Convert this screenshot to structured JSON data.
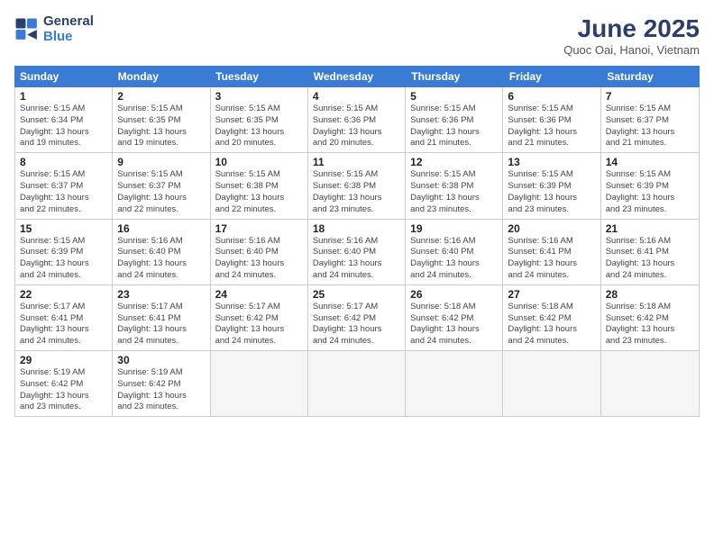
{
  "logo": {
    "line1": "General",
    "line2": "Blue"
  },
  "title": "June 2025",
  "subtitle": "Quoc Oai, Hanoi, Vietnam",
  "header_days": [
    "Sunday",
    "Monday",
    "Tuesday",
    "Wednesday",
    "Thursday",
    "Friday",
    "Saturday"
  ],
  "rows": [
    [
      {
        "day": "1",
        "info": "Sunrise: 5:15 AM\nSunset: 6:34 PM\nDaylight: 13 hours\nand 19 minutes."
      },
      {
        "day": "2",
        "info": "Sunrise: 5:15 AM\nSunset: 6:35 PM\nDaylight: 13 hours\nand 19 minutes."
      },
      {
        "day": "3",
        "info": "Sunrise: 5:15 AM\nSunset: 6:35 PM\nDaylight: 13 hours\nand 20 minutes."
      },
      {
        "day": "4",
        "info": "Sunrise: 5:15 AM\nSunset: 6:36 PM\nDaylight: 13 hours\nand 20 minutes."
      },
      {
        "day": "5",
        "info": "Sunrise: 5:15 AM\nSunset: 6:36 PM\nDaylight: 13 hours\nand 21 minutes."
      },
      {
        "day": "6",
        "info": "Sunrise: 5:15 AM\nSunset: 6:36 PM\nDaylight: 13 hours\nand 21 minutes."
      },
      {
        "day": "7",
        "info": "Sunrise: 5:15 AM\nSunset: 6:37 PM\nDaylight: 13 hours\nand 21 minutes."
      }
    ],
    [
      {
        "day": "8",
        "info": "Sunrise: 5:15 AM\nSunset: 6:37 PM\nDaylight: 13 hours\nand 22 minutes."
      },
      {
        "day": "9",
        "info": "Sunrise: 5:15 AM\nSunset: 6:37 PM\nDaylight: 13 hours\nand 22 minutes."
      },
      {
        "day": "10",
        "info": "Sunrise: 5:15 AM\nSunset: 6:38 PM\nDaylight: 13 hours\nand 22 minutes."
      },
      {
        "day": "11",
        "info": "Sunrise: 5:15 AM\nSunset: 6:38 PM\nDaylight: 13 hours\nand 23 minutes."
      },
      {
        "day": "12",
        "info": "Sunrise: 5:15 AM\nSunset: 6:38 PM\nDaylight: 13 hours\nand 23 minutes."
      },
      {
        "day": "13",
        "info": "Sunrise: 5:15 AM\nSunset: 6:39 PM\nDaylight: 13 hours\nand 23 minutes."
      },
      {
        "day": "14",
        "info": "Sunrise: 5:15 AM\nSunset: 6:39 PM\nDaylight: 13 hours\nand 23 minutes."
      }
    ],
    [
      {
        "day": "15",
        "info": "Sunrise: 5:15 AM\nSunset: 6:39 PM\nDaylight: 13 hours\nand 24 minutes."
      },
      {
        "day": "16",
        "info": "Sunrise: 5:16 AM\nSunset: 6:40 PM\nDaylight: 13 hours\nand 24 minutes."
      },
      {
        "day": "17",
        "info": "Sunrise: 5:16 AM\nSunset: 6:40 PM\nDaylight: 13 hours\nand 24 minutes."
      },
      {
        "day": "18",
        "info": "Sunrise: 5:16 AM\nSunset: 6:40 PM\nDaylight: 13 hours\nand 24 minutes."
      },
      {
        "day": "19",
        "info": "Sunrise: 5:16 AM\nSunset: 6:40 PM\nDaylight: 13 hours\nand 24 minutes."
      },
      {
        "day": "20",
        "info": "Sunrise: 5:16 AM\nSunset: 6:41 PM\nDaylight: 13 hours\nand 24 minutes."
      },
      {
        "day": "21",
        "info": "Sunrise: 5:16 AM\nSunset: 6:41 PM\nDaylight: 13 hours\nand 24 minutes."
      }
    ],
    [
      {
        "day": "22",
        "info": "Sunrise: 5:17 AM\nSunset: 6:41 PM\nDaylight: 13 hours\nand 24 minutes."
      },
      {
        "day": "23",
        "info": "Sunrise: 5:17 AM\nSunset: 6:41 PM\nDaylight: 13 hours\nand 24 minutes."
      },
      {
        "day": "24",
        "info": "Sunrise: 5:17 AM\nSunset: 6:42 PM\nDaylight: 13 hours\nand 24 minutes."
      },
      {
        "day": "25",
        "info": "Sunrise: 5:17 AM\nSunset: 6:42 PM\nDaylight: 13 hours\nand 24 minutes."
      },
      {
        "day": "26",
        "info": "Sunrise: 5:18 AM\nSunset: 6:42 PM\nDaylight: 13 hours\nand 24 minutes."
      },
      {
        "day": "27",
        "info": "Sunrise: 5:18 AM\nSunset: 6:42 PM\nDaylight: 13 hours\nand 24 minutes."
      },
      {
        "day": "28",
        "info": "Sunrise: 5:18 AM\nSunset: 6:42 PM\nDaylight: 13 hours\nand 23 minutes."
      }
    ],
    [
      {
        "day": "29",
        "info": "Sunrise: 5:19 AM\nSunset: 6:42 PM\nDaylight: 13 hours\nand 23 minutes."
      },
      {
        "day": "30",
        "info": "Sunrise: 5:19 AM\nSunset: 6:42 PM\nDaylight: 13 hours\nand 23 minutes."
      },
      {
        "day": "",
        "info": ""
      },
      {
        "day": "",
        "info": ""
      },
      {
        "day": "",
        "info": ""
      },
      {
        "day": "",
        "info": ""
      },
      {
        "day": "",
        "info": ""
      }
    ]
  ]
}
